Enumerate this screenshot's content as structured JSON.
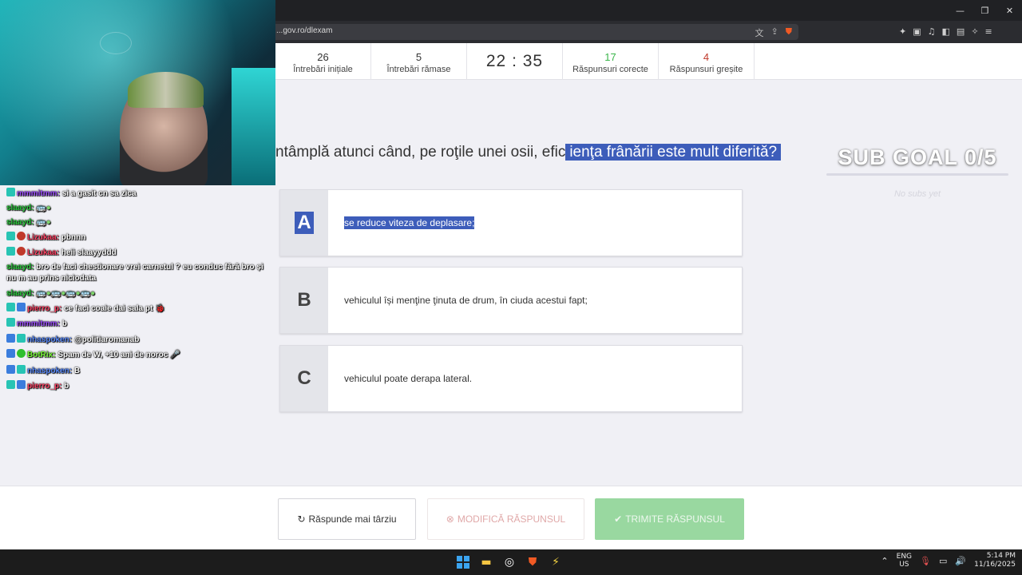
{
  "browser": {
    "url": "...gov.ro/dlexam",
    "window_controls": [
      "—",
      "❐",
      "✕"
    ]
  },
  "stats": {
    "initial_count": "26",
    "initial_label": "Întrebări inițiale",
    "remaining_count": "5",
    "remaining_label": "Întrebări rămase",
    "timer": "22 : 35",
    "correct_count": "17",
    "correct_label": "Răspunsuri corecte",
    "wrong_count": "4",
    "wrong_label": "Răspunsuri greșite"
  },
  "question": {
    "text_plain": "ntâmplă atunci când, pe roţile unei osii, efic",
    "text_selected": "ienţa frânării este mult diferită?"
  },
  "answers": [
    {
      "letter": "A",
      "text": "se reduce viteza de deplasare;",
      "selected": true
    },
    {
      "letter": "B",
      "text": "vehiculul își menţine ţinuta de drum, în ciuda acestui fapt;",
      "selected": false
    },
    {
      "letter": "C",
      "text": "vehiculul poate derapa lateral.",
      "selected": false
    }
  ],
  "buttons": {
    "later": "Răspunde mai târziu",
    "modify": "MODIFICĂ RĂSPUNSUL",
    "send": "TRIMITE RĂSPUNSUL"
  },
  "overlay": {
    "subgoal": "SUB GOAL 0/5",
    "no_subs": "No subs yet"
  },
  "chat": [
    {
      "user": "mmmitmm:",
      "text": "si a gasit cn sa zica"
    },
    {
      "user": "slaayd:",
      "text": "🚌●"
    },
    {
      "user": "slaayd:",
      "text": "🚌●"
    },
    {
      "user": "Lizukaa:",
      "text": "pbnnn"
    },
    {
      "user": "Lizukaa:",
      "text": "heii slaayyddd"
    },
    {
      "user": "slaayd:",
      "text": "bro de faci chestionare vrei carnetul ? eu conduc fără bro și nu m au prins niciodata"
    },
    {
      "user": "slaayd:",
      "text": "🚌●🚌●🚌●🚌●"
    },
    {
      "user": "pierro_p:",
      "text": "ce faci coaie dai sala pt 🐞"
    },
    {
      "user": "mmmitmm:",
      "text": "b"
    },
    {
      "user": "nhaspoken:",
      "text": "@politiaromanab"
    },
    {
      "user": "BotRix:",
      "text": "Spam de W, +10 ani de noroc 🎤"
    },
    {
      "user": "nhaspoken:",
      "text": "B"
    },
    {
      "user": "pierro_p:",
      "text": "b"
    }
  ],
  "taskbar": {
    "lang_top": "ENG",
    "lang_bottom": "US",
    "time": "5:14 PM",
    "date": "11/16/2025"
  }
}
